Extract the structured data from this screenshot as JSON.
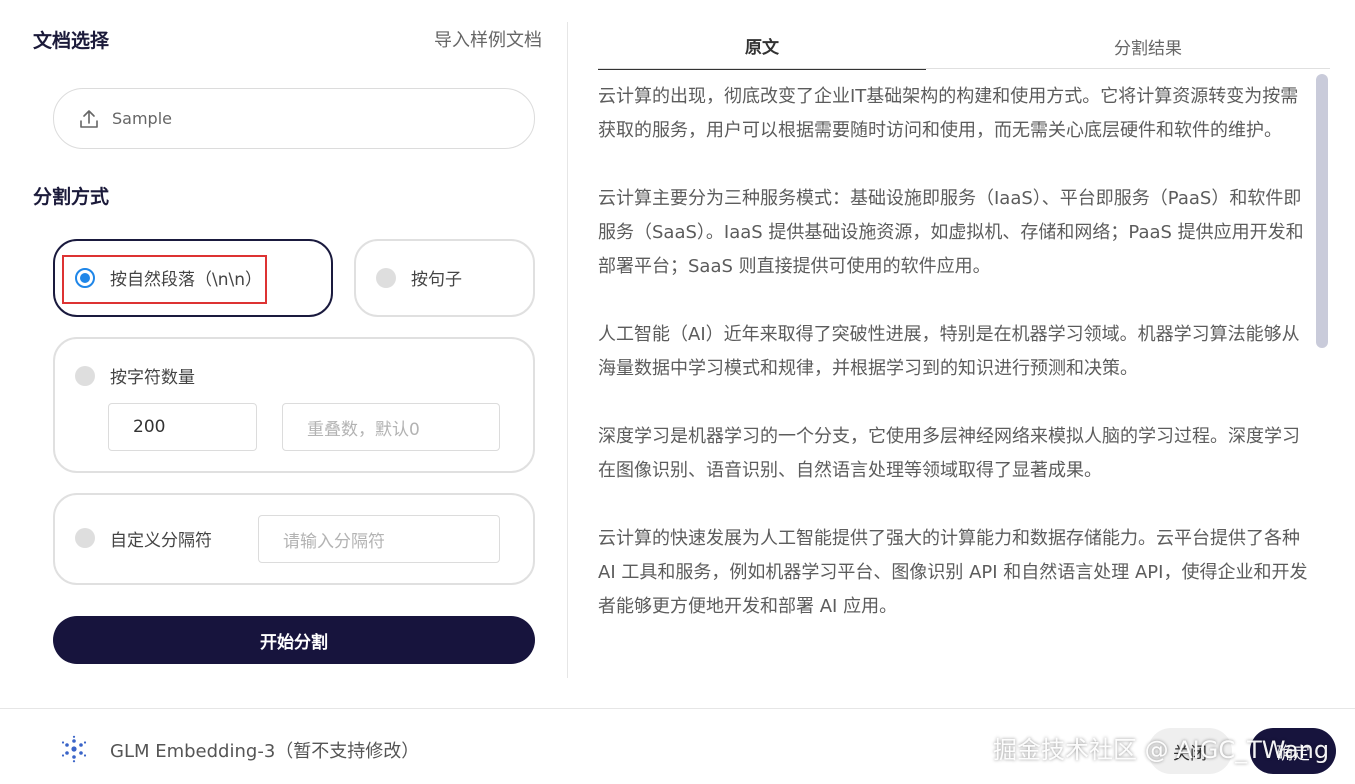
{
  "left": {
    "doc_section_title": "文档选择",
    "import_link": "导入样例文档",
    "upload_label": "Sample",
    "split_section_title": "分割方式",
    "options": {
      "paragraph": "按自然段落（\\n\\n）",
      "sentence": "按句子",
      "char_count": "按字符数量",
      "custom": "自定义分隔符"
    },
    "char_count_value": "200",
    "overlap_placeholder": "重叠数，默认0",
    "separator_placeholder": "请输入分隔符",
    "start_button": "开始分割"
  },
  "right": {
    "tabs": [
      "原文",
      "分割结果"
    ],
    "paragraphs": [
      "云计算的出现，彻底改变了企业IT基础架构的构建和使用方式。它将计算资源转变为按需获取的服务，用户可以根据需要随时访问和使用，而无需关心底层硬件和软件的维护。",
      "云计算主要分为三种服务模式：基础设施即服务（IaaS）、平台即服务（PaaS）和软件即服务（SaaS）。IaaS 提供基础设施资源，如虚拟机、存储和网络；PaaS 提供应用开发和部署平台；SaaS 则直接提供可使用的软件应用。",
      "人工智能（AI）近年来取得了突破性进展，特别是在机器学习领域。机器学习算法能够从海量数据中学习模式和规律，并根据学习到的知识进行预测和决策。",
      "深度学习是机器学习的一个分支，它使用多层神经网络来模拟人脑的学习过程。深度学习在图像识别、语音识别、自然语言处理等领域取得了显著成果。",
      "云计算的快速发展为人工智能提供了强大的计算能力和数据存储能力。云平台提供了各种 AI 工具和服务，例如机器学习平台、图像识别 API 和自然语言处理 API，使得企业和开发者能够更方便地开发和部署 AI 应用。"
    ]
  },
  "footer": {
    "model_label": "GLM Embedding-3（暂不支持修改）",
    "close_button": "关闭",
    "ok_button": "确定",
    "watermark": "掘金技术社区 @ AIGC_TWang"
  },
  "colors": {
    "primary_dark": "#17143d",
    "radio_checked": "#1f86e8",
    "highlight_border": "#dd3333"
  }
}
